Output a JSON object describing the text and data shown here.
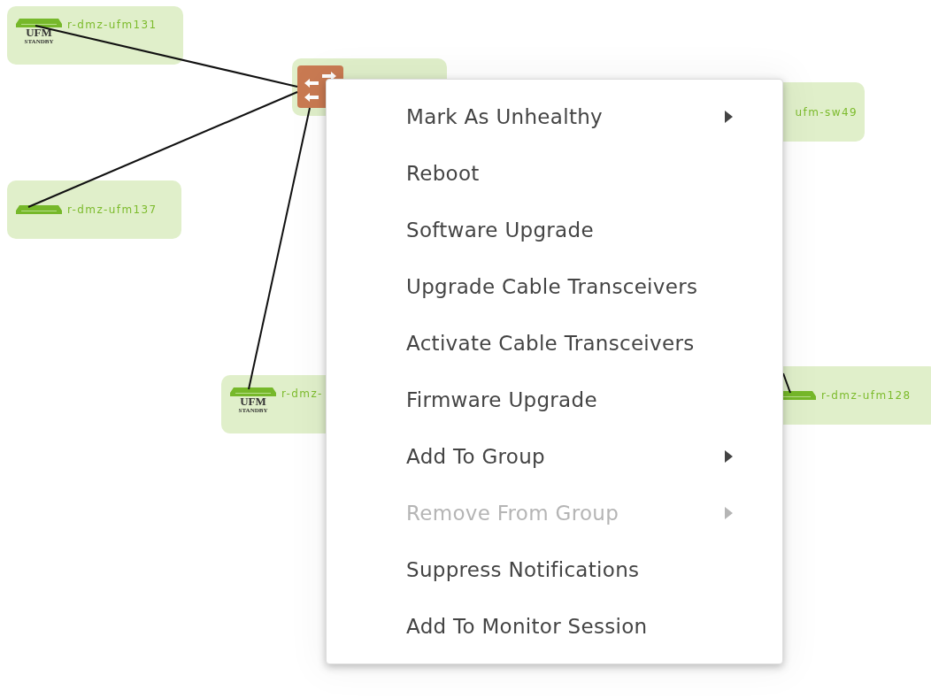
{
  "nodes": [
    {
      "kind": "host",
      "label": "r-dmz-ufm131",
      "badge": [
        "UFM",
        "STANDBY"
      ]
    },
    {
      "kind": "switch"
    },
    {
      "kind": "host",
      "label": "r-dmz-ufm137"
    },
    {
      "kind": "host",
      "label": "r-dmz-",
      "badge": [
        "UFM",
        "STANDBY"
      ]
    },
    {
      "kind": "tail",
      "label": "ufm-sw49"
    },
    {
      "kind": "host",
      "label": "r-dmz-ufm128"
    }
  ],
  "context_menu": {
    "items": [
      {
        "label": "Mark As Unhealthy",
        "submenu": true,
        "disabled": false
      },
      {
        "label": "Reboot",
        "submenu": false,
        "disabled": false
      },
      {
        "label": "Software Upgrade",
        "submenu": false,
        "disabled": false
      },
      {
        "label": "Upgrade Cable Transceivers",
        "submenu": false,
        "disabled": false
      },
      {
        "label": "Activate Cable Transceivers",
        "submenu": false,
        "disabled": false
      },
      {
        "label": "Firmware Upgrade",
        "submenu": false,
        "disabled": false
      },
      {
        "label": "Add To Group",
        "submenu": true,
        "disabled": false
      },
      {
        "label": "Remove From Group",
        "submenu": true,
        "disabled": true
      },
      {
        "label": "Suppress Notifications",
        "submenu": false,
        "disabled": false
      },
      {
        "label": "Add To Monitor Session",
        "submenu": false,
        "disabled": false
      }
    ]
  }
}
